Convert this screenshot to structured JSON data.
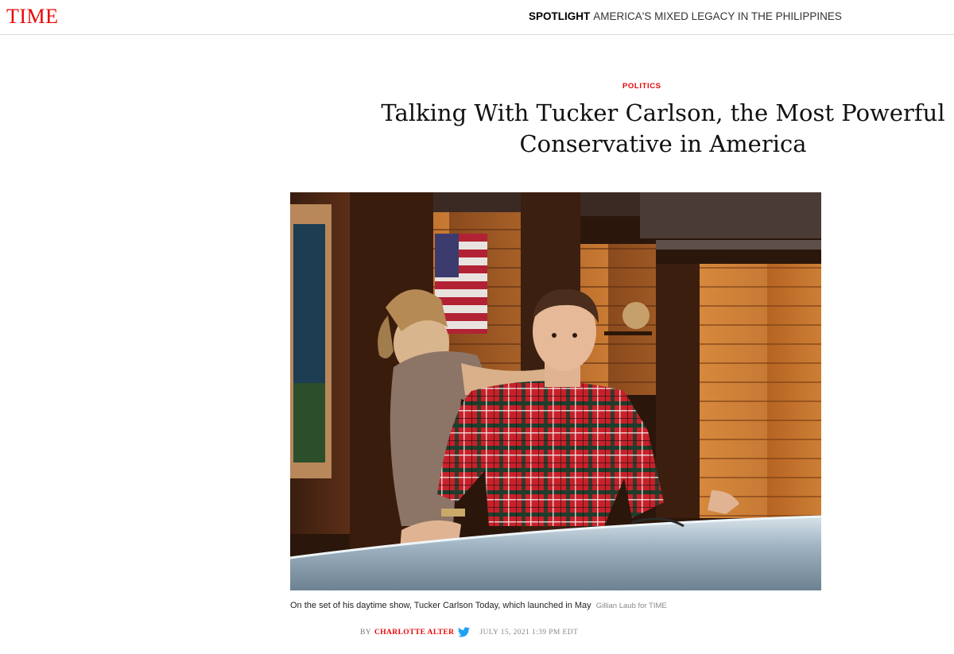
{
  "header": {
    "logo": "TIME",
    "spotlight_kicker": "Spotlight",
    "spotlight_headline": "America's Mixed Legacy in the Philippines"
  },
  "article": {
    "section": "Politics",
    "title": "Talking With Tucker Carlson, the Most Powerful Conservative in America",
    "image": {
      "caption": "On the set of his daytime show, Tucker Carlson Today, which launched in May",
      "credit": "Gillian Laub for TIME"
    },
    "byline": {
      "by": "By",
      "author": "Charlotte Alter",
      "date": "July 15, 2021 1:39 PM EDT"
    }
  },
  "colors": {
    "brand_red": "#e90606",
    "text": "#111111",
    "muted": "#888888",
    "twitter_blue": "#1da1f2"
  },
  "icons": [
    "twitter-icon"
  ]
}
